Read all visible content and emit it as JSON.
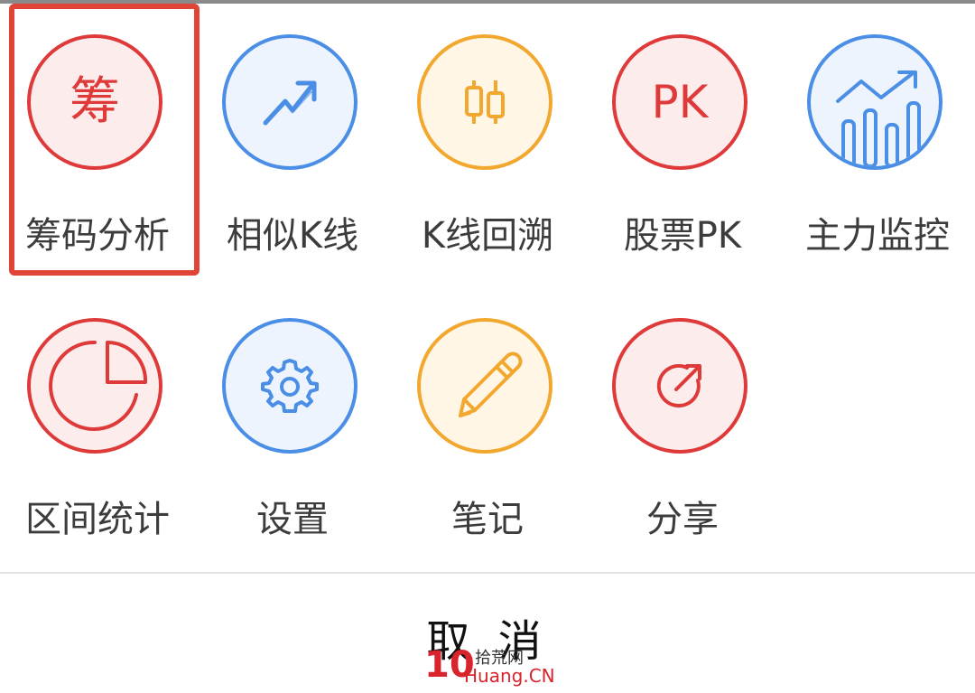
{
  "menu": {
    "items": [
      {
        "label": "筹码分析",
        "icon": "chip-analysis-icon",
        "glyph": "筹",
        "color": "red"
      },
      {
        "label": "相似K线",
        "icon": "trend-arrow-icon",
        "color": "blue"
      },
      {
        "label": "K线回溯",
        "icon": "candlestick-icon",
        "color": "orange"
      },
      {
        "label": "股票PK",
        "icon": "pk-icon",
        "glyph": "PK",
        "color": "red"
      },
      {
        "label": "主力监控",
        "icon": "bar-trend-icon",
        "color": "blue"
      },
      {
        "label": "区间统计",
        "icon": "pie-chart-icon",
        "color": "red"
      },
      {
        "label": "设置",
        "icon": "gear-icon",
        "color": "blue"
      },
      {
        "label": "笔记",
        "icon": "pencil-icon",
        "color": "orange"
      },
      {
        "label": "分享",
        "icon": "share-icon",
        "color": "red"
      }
    ],
    "selected": "筹码分析"
  },
  "cancel": {
    "label": "取 消"
  },
  "watermark": {
    "logo": "10",
    "cn": "拾荒网",
    "en": "Huang.CN"
  },
  "colors": {
    "red": "#df3a3a",
    "blue": "#4a8ee6",
    "orange": "#f2a82f",
    "highlight": "#e04437"
  }
}
